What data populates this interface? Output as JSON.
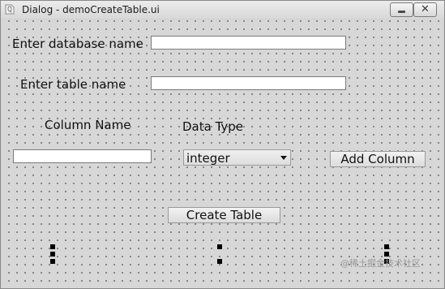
{
  "window": {
    "title": "Dialog - demoCreateTable.ui",
    "minimize_icon": "minimize-icon",
    "close_icon": "close-icon",
    "close_glyph": "✕"
  },
  "form": {
    "database_label": "Enter database name",
    "database_value": "",
    "table_label": "Enter table name",
    "table_value": "",
    "column_name_header": "Column Name",
    "data_type_header": "Data Type",
    "column_name_value": "",
    "data_type_selected": "integer",
    "add_column_button": "Add Column",
    "create_table_button": "Create Table"
  },
  "watermark": "@稀土掘金技术社区"
}
